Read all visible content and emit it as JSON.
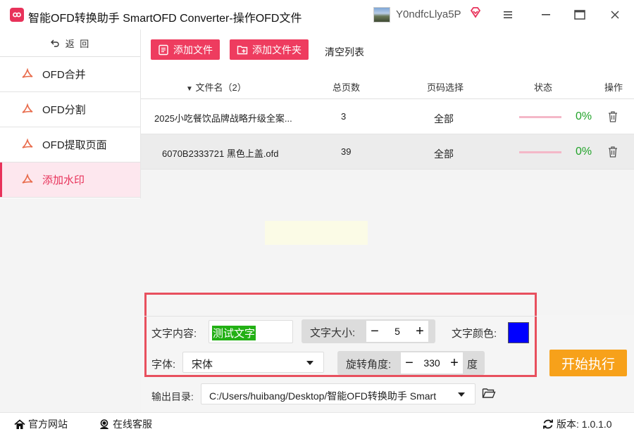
{
  "window": {
    "title": "智能OFD转换助手 SmartOFD Converter-操作OFD文件",
    "user_name": "Y0ndfcLlya5P",
    "brand_color": "#e8325a"
  },
  "sidebar": {
    "back_label": "返 回",
    "items": [
      {
        "label": "OFD合并",
        "icon": "pdf-icon"
      },
      {
        "label": "OFD分割",
        "icon": "pdf-icon"
      },
      {
        "label": "OFD提取页面",
        "icon": "pdf-icon"
      },
      {
        "label": "添加水印",
        "icon": "pdf-icon",
        "active": true
      }
    ]
  },
  "toolbar": {
    "add_file_label": "添加文件",
    "add_folder_label": "添加文件夹",
    "clear_label": "清空列表"
  },
  "table": {
    "headers": {
      "name": "文件名（2）",
      "pages": "总页数",
      "range": "页码选择",
      "status": "状态",
      "op": "操作"
    },
    "rows": [
      {
        "name": "2025小吃餐饮品牌战略升级全案...",
        "pages": "3",
        "range": "全部",
        "progress_pct": 0,
        "status": "0%"
      },
      {
        "name": "6070B2333721 黑色上盖.ofd",
        "pages": "39",
        "range": "全部",
        "progress_pct": 0,
        "status": "0%"
      }
    ]
  },
  "watermark": {
    "text_label": "文字内容:",
    "text_value": "测试文字",
    "size_label": "文字大小:",
    "size_value": "5",
    "color_label": "文字颜色:",
    "color_value": "#0000ff",
    "font_label": "字体:",
    "font_value": "宋体",
    "rotation_label": "旋转角度:",
    "rotation_value": "330",
    "rotation_unit": "度"
  },
  "start_label": "开始执行",
  "output": {
    "label": "输出目录:",
    "path": "C:/Users/huibang/Desktop/智能OFD转换助手 Smart"
  },
  "footer": {
    "site_label": "官方网站",
    "service_label": "在线客服",
    "version_label": "版本: 1.0.1.0"
  }
}
